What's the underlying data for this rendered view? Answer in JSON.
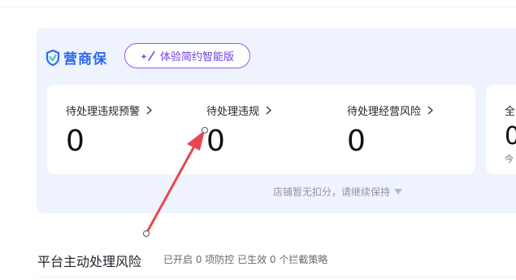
{
  "brand": {
    "name": "营商保",
    "icon": "shield-icon",
    "color": "#2e67f0"
  },
  "trial_button": {
    "label": "体验简约智能版",
    "icon": "sparkle-icon",
    "accent": "#8b5cf6"
  },
  "metrics": [
    {
      "label": "待处理违规预警",
      "value": "0"
    },
    {
      "label": "待处理违规",
      "value": "0"
    },
    {
      "label": "待处理经营风险",
      "value": "0"
    }
  ],
  "side_card": {
    "label": "全",
    "value": "0",
    "sub": "今"
  },
  "status_text": "店铺暂无扣分，请继续保持",
  "section": {
    "title": "平台主动处理风险",
    "subtitle": "已开启 0 项防控 已生效 0 个拦截策略"
  },
  "annotation": {
    "type": "arrow",
    "color": "#e8464f"
  }
}
